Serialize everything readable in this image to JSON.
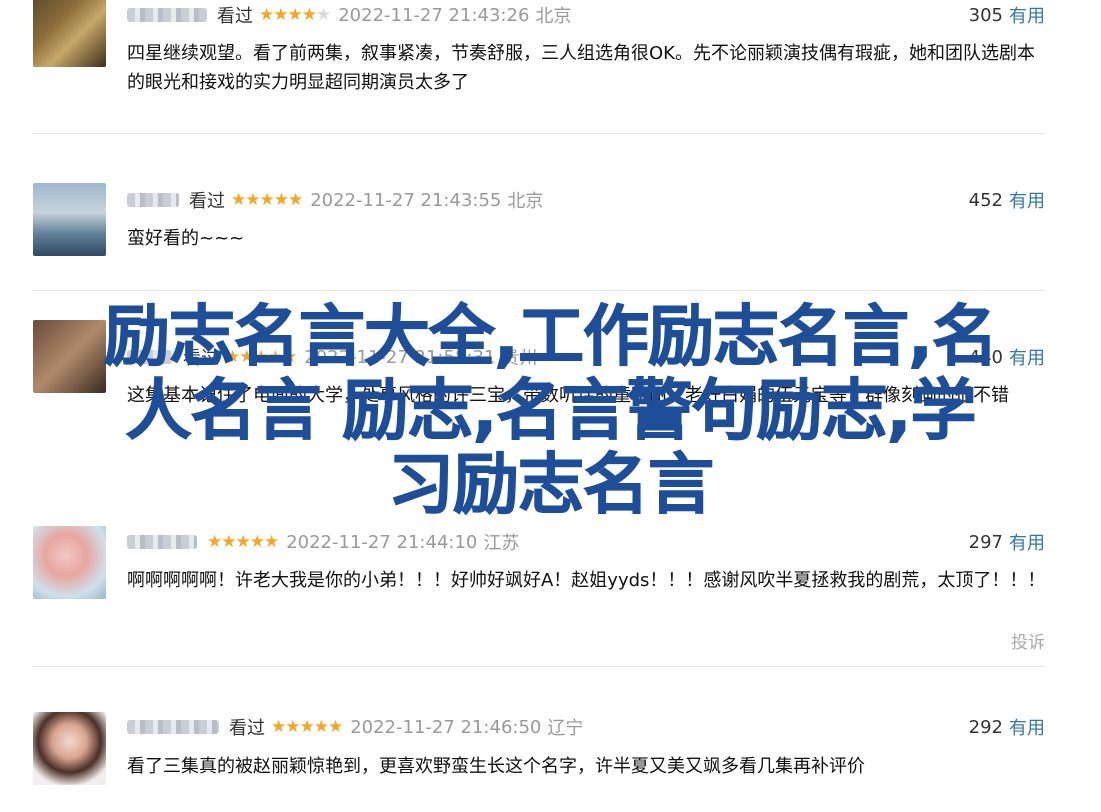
{
  "reviews": [
    {
      "username": "▇▇ ▇▇▇▇",
      "watched": "看过",
      "stars": 4,
      "stars_filled": "★★★★",
      "stars_empty": "★",
      "time": "2022-11-27 21:43:26",
      "location": "北京",
      "votes": "305",
      "useful": "有用",
      "content": "四星继续观望。看了前两集，叙事紧凑，节奏舒服，三人组选角很OK。先不论丽颖演技偶有瑕疵，她和团队选剧本的眼光和接戏的实力明显超同期演员太多了"
    },
    {
      "username": "▇▇▇",
      "watched": "看过",
      "stars": 5,
      "stars_filled": "★★★★★",
      "stars_empty": "",
      "time": "2022-11-27 21:43:55",
      "location": "北京",
      "votes": "452",
      "useful": "有用",
      "content": "蛮好看的~~~"
    },
    {
      "username": "▇▇",
      "watched": "看过",
      "stars": 5,
      "stars_filled": "★★★★★",
      "stars_empty": "",
      "time": "2022-11-27 21:58:31",
      "location": "贵州",
      "votes": "440",
      "useful": "有用",
      "content": "这集基本记住了电面的大学，处事风格的许三宝，带数听话的童晓丽，老好白娟的伍元宝等，群像刻画的很不错"
    },
    {
      "username": "▇▇▇▇",
      "watched": "",
      "stars": 5,
      "stars_filled": "★★★★★",
      "stars_empty": "",
      "time": "2022-11-27 21:44:10",
      "location": "江苏",
      "votes": "297",
      "useful": "有用",
      "content": "啊啊啊啊啊！许老大我是你的小弟！！！好帅好飒好A！赵姐yyds！！！感谢风吹半夏拯救我的剧荒，太顶了！！！",
      "report": "投诉"
    },
    {
      "username": "▇▇▇▇▇",
      "watched": "看过",
      "stars": 5,
      "stars_filled": "★★★★★",
      "stars_empty": "",
      "time": "2022-11-27 21:46:50",
      "location": "辽宁",
      "votes": "292",
      "useful": "有用",
      "content": "看了三集真的被赵丽颖惊艳到，更喜欢野蛮生长这个名字，许半夏又美又飒多看几集再补评价"
    }
  ],
  "overlay": {
    "line1": "励志名言大全,工作励志名言,名",
    "line2": "人名言 励志,名言警句励志,学",
    "line3": "习励志名言"
  },
  "colors": {
    "star": "#f5a623",
    "useful_link": "#3377aa",
    "overlay_text": "#1f4e99",
    "meta_gray": "#999999"
  }
}
